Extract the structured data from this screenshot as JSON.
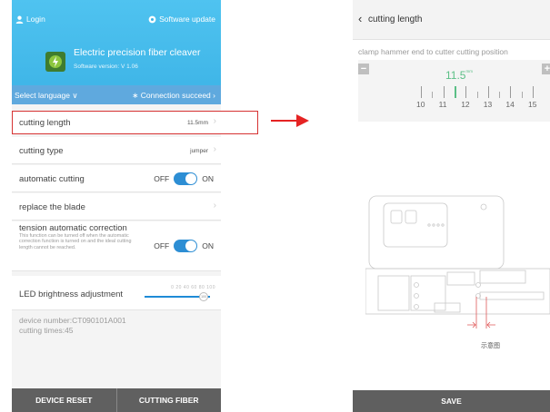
{
  "left_screen": {
    "header": {
      "login": "Login",
      "software_update": "Software update",
      "app_title": "Electric precision fiber cleaver",
      "software_version": "Software version: V 1.06",
      "select_language": "Select language",
      "connection_status": "Connection succeed"
    },
    "settings": {
      "cutting_length": {
        "label": "cutting length",
        "value": "11.5mm"
      },
      "cutting_type": {
        "label": "cutting type",
        "value": "jumper"
      },
      "automatic_cutting": {
        "label": "automatic cutting",
        "off": "OFF",
        "on": "ON"
      },
      "replace_blade": {
        "label": "replace the blade"
      },
      "tension": {
        "label": "tension automatic correction",
        "description": "This function can be turned off when the automatic correction function is turned on and the ideal cutting length cannot be reached.",
        "off": "OFF",
        "on": "ON"
      },
      "led": {
        "label": "LED brightness adjustment",
        "scale": "0 20 40 60 80 100",
        "knob": "100"
      }
    },
    "device_info": {
      "device_number": "device number:CT090101A001",
      "cutting_times": "cutting times:45"
    },
    "buttons": {
      "reset": "DEVICE RESET",
      "cut": "CUTTING FIBER"
    }
  },
  "right_screen": {
    "title": "cutting length",
    "clamp_label": "clamp hammer end to cutter cutting position",
    "minus": "−",
    "plus": "+",
    "current_value": "11.5",
    "current_unit": "mm",
    "scale_labels": [
      "10",
      "11",
      "12",
      "13",
      "14",
      "15"
    ],
    "diagram_caption": "示意图",
    "save": "SAVE"
  },
  "colors": {
    "header_blue": "#3cb3e6",
    "toggle_blue": "#2d8ed4",
    "highlight_red": "#d63232",
    "value_green": "#5bbf86",
    "button_gray": "#606060"
  }
}
